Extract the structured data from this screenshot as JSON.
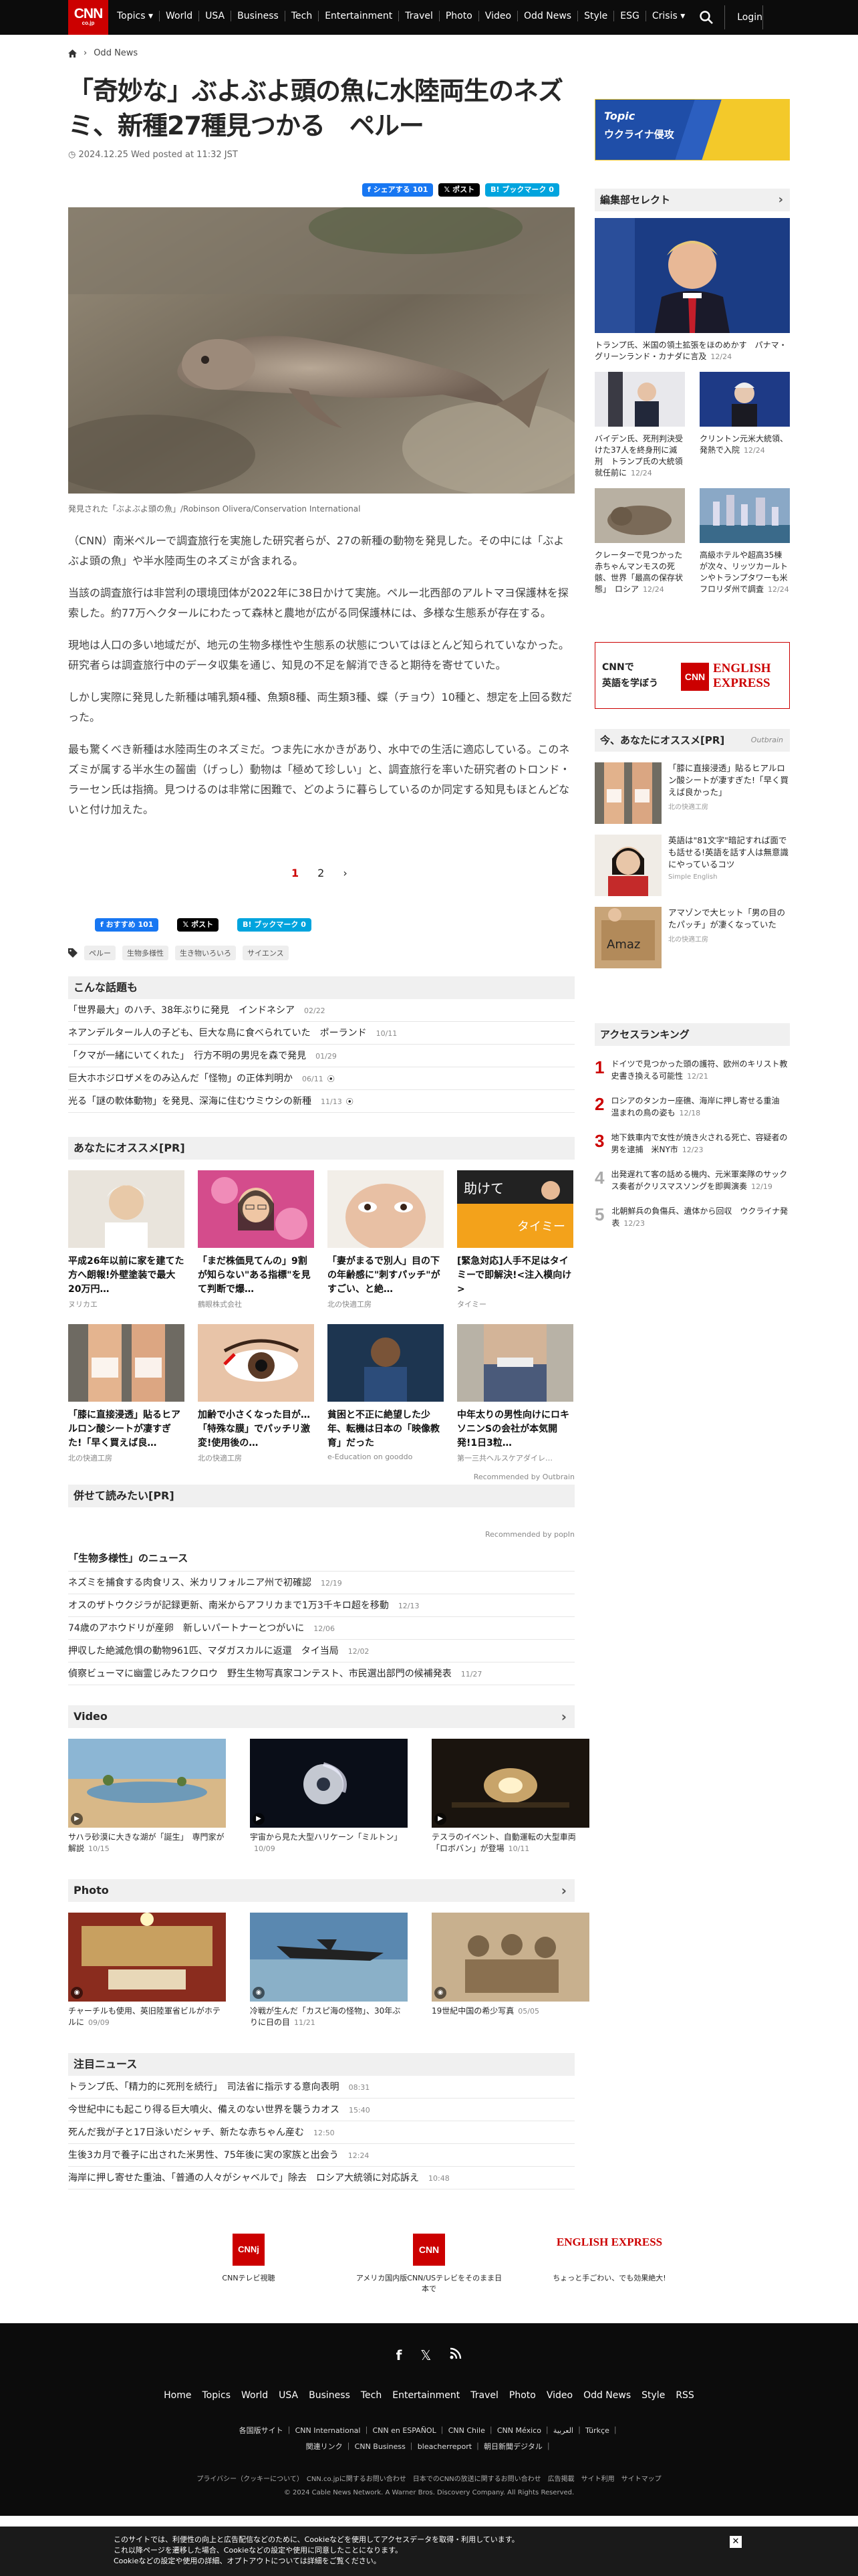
{
  "header": {
    "logo": "CNN",
    "logo_sub": "co.jp",
    "nav": [
      "Topics ▾",
      "World",
      "USA",
      "Business",
      "Tech",
      "Entertainment",
      "Travel",
      "Photo",
      "Video",
      "Odd News",
      "Style",
      "ESG",
      "Crisis ▾"
    ],
    "login": "Login"
  },
  "breadcrumb": {
    "current": "Odd News"
  },
  "article": {
    "title": "「奇妙な」ぶよぶよ頭の魚に水陸両生のネズミ、新種27種見つかる　ペルー",
    "date": "2024.12.25 Wed posted at 11:32 JST",
    "share": {
      "facebook": "シェアする 101",
      "x": "ポスト",
      "hatena": "ブックマーク 0"
    },
    "image_caption": "発見された「ぶよぶよ頭の魚」/Robinson Olivera/Conservation International",
    "paragraphs": [
      "（CNN）南米ペルーで調査旅行を実施した研究者らが、27の新種の動物を発見した。その中には「ぶよぶよ頭の魚」や半水陸両生のネズミが含まれる。",
      "当該の調査旅行は非営利の環境団体が2022年に38日かけて実施。ペルー北西部のアルトマヨ保護林を探索した。約77万ヘクタールにわたって森林と農地が広がる同保護林には、多様な生態系が存在する。",
      "現地は人口の多い地域だが、地元の生物多様性や生態系の状態についてはほとんど知られていなかった。研究者らは調査旅行中のデータ収集を通じ、知見の不足を解消できると期待を寄せていた。",
      "しかし実際に発見した新種は哺乳類4種、魚類8種、両生類3種、蝶（チョウ）10種と、想定を上回る数だった。",
      "最も驚くべき新種は水陸両生のネズミだ。つま先に水かきがあり、水中での生活に適応している。このネズミが属する半水生の齧歯（げっし）動物は「極めて珍しい」と、調査旅行を率いた研究者のトロンド・ラーセン氏は指摘。見つけるのは非常に困難で、どのように暮らしているのか同定する知見もほとんどないと付け加えた。"
    ],
    "pager": [
      "1",
      "2",
      "›"
    ],
    "share2": {
      "facebook": "おすすめ 101",
      "x": "ポスト",
      "hatena": "ブックマーク 0"
    },
    "tags": [
      "ペルー",
      "生物多様性",
      "生き物いろいろ",
      "サイエンス"
    ]
  },
  "related": {
    "heading": "こんな話題も",
    "items": [
      {
        "t": "「世界最大」のハチ、38年ぶりに発見　インドネシア",
        "d": "02/22"
      },
      {
        "t": "ネアンデルタール人の子ども、巨大な鳥に食べられていた　ポーランド",
        "d": "10/11"
      },
      {
        "t": "「クマが一緒にいてくれた」　行方不明の男児を森で発見",
        "d": "01/29"
      },
      {
        "t": "巨大ホホジロザメをのみ込んだ「怪物」の正体判明か",
        "d": "06/11"
      },
      {
        "t": "光る「謎の軟体動物」を発見、深海に住むウミウシの新種",
        "d": "11/13"
      }
    ]
  },
  "reco": {
    "heading": "あなたにオススメ[PR]",
    "cards": [
      {
        "t": "平成26年以前に家を建てた方へ朗報!外壁塗装で最大20万円…",
        "s": "ヌリカエ"
      },
      {
        "t": "「まだ株価見てんの」9割が知らない\"ある指標\"を見て判断で爆…",
        "s": "鶴眼株式会社"
      },
      {
        "t": "「妻がまるで別人」目の下の年齢感に\"刺すパッチ\"がすごい、と絶…",
        "s": "北の快適工房"
      },
      {
        "t": "[緊急対応]人手不足はタイミーで即解決!<注入模向け>",
        "s": "タイミー"
      },
      {
        "t": "「膝に直接浸透」貼るヒアルロン酸シートが凄すぎた!「早く買えば良…",
        "s": "北の快適工房"
      },
      {
        "t": "加齢で小さくなった目が…「特殊な膜」でパッチリ激変!使用後の…",
        "s": "北の快適工房"
      },
      {
        "t": "貧困と不正に絶望した少年、転機は日本の「映像教育」だった",
        "s": "e-Education on gooddo"
      },
      {
        "t": "中年太りの男性向けにロキソニンSの会社が本気開発!1日3粒…",
        "s": "第一三共ヘルスケアダイレ…"
      }
    ],
    "footer": "Recommended by Outbrain"
  },
  "also": {
    "heading": "併せて読みたい[PR]",
    "powered": "Recommended by popIn"
  },
  "bio": {
    "heading": "「生物多様性」のニュース",
    "items": [
      {
        "t": "ネズミを捕食する肉食リス、米カリフォルニア州で初確認",
        "d": "12/19"
      },
      {
        "t": "オスのザトウクジラが記録更新、南米からアフリカまで1万3千キロ超を移動",
        "d": "12/13"
      },
      {
        "t": "74歳のアホウドリが産卵　新しいパートナーとつがいに",
        "d": "12/06"
      },
      {
        "t": "押収した絶滅危惧の動物961匹、マダガスカルに返還　タイ当局",
        "d": "12/02"
      },
      {
        "t": "偵察ビューマに幽霊じみたフクロウ　野生生物写真家コンテスト、市民選出部門の候補発表",
        "d": "11/27"
      }
    ]
  },
  "video": {
    "heading": "Video",
    "items": [
      {
        "t": "サハラ砂漠に大きな湖が「誕生」　専門家が解説",
        "d": "10/15"
      },
      {
        "t": "宇宙から見た大型ハリケーン「ミルトン」",
        "d": "10/09"
      },
      {
        "t": "テスラのイベント、自動運転の大型車両「ロボバン」が登場",
        "d": "10/11"
      }
    ]
  },
  "photo": {
    "heading": "Photo",
    "items": [
      {
        "t": "チャーチルも使用、英旧陸軍省ビルがホテルに",
        "d": "09/09"
      },
      {
        "t": "冷戦が生んだ「カスピ海の怪物」、30年ぶりに日の目",
        "d": "11/21"
      },
      {
        "t": "19世紀中国の希少写真",
        "d": "05/05"
      }
    ]
  },
  "attn": {
    "heading": "注目ニュース",
    "items": [
      {
        "t": "トランプ氏、「精力的に死刑を続行」　司法省に指示する意向表明",
        "d": "08:31"
      },
      {
        "t": "今世紀中にも起こり得る巨大噴火、備えのない世界を襲うカオス",
        "d": "15:40"
      },
      {
        "t": "死んだ我が子と17日泳いだシャチ、新たな赤ちゃん産む",
        "d": "12:50"
      },
      {
        "t": "生後3カ月で養子に出された米男性、75年後に実の家族と出会う",
        "d": "12:24"
      },
      {
        "t": "海岸に押し寄せた重油、「普通の人々がシャベルで」除去　ロシア大統領に対応訴え",
        "d": "10:48"
      }
    ]
  },
  "right": {
    "topic_label": "Topic",
    "topic_title": "ウクライナ侵攻",
    "editors": {
      "heading": "編集部セレクト",
      "big": {
        "t": "トランプ氏、米国の領土拡張をほのめかす　パナマ・グリーンランド・カナダに言及",
        "d": "12/24"
      },
      "pairs": [
        {
          "t": "バイデン氏、死刑判決受けた37人を終身刑に減刑　トランプ氏の大統領就任前に",
          "d": "12/24"
        },
        {
          "t": "クリントン元米大統領、発熱で入院",
          "d": "12/24"
        },
        {
          "t": "クレーターで見つかった赤ちゃんマンモスの死骸、世界「最高の保存状態」　ロシア",
          "d": "12/24"
        },
        {
          "t": "高級ホテルや超高35棟が次々、リッツカールトンやトランプタワーも米フロリダ州で調査",
          "d": "12/24"
        }
      ]
    },
    "english": {
      "l1": "CNNで",
      "l2": "英語を学ぼう",
      "logo": "ENGLISH EXPRESS"
    },
    "outbrain": {
      "heading": "今、あなたにオススメ[PR]",
      "brand": "Outbrain",
      "items": [
        {
          "t": "「膝に直接浸透」貼るヒアルロン酸シートが凄すぎた!「早く買えば良かった」",
          "s": "北の快適工房"
        },
        {
          "t": "英語は\"81文字\"暗記すれば面でも話せる!英語を話す人は無意識にやっているコツ",
          "s": "Simple English"
        },
        {
          "t": "アマゾンで大ヒット「男の目のたパッチ」が凄くなっていた",
          "s": "北の快適工房"
        }
      ]
    },
    "ranking": {
      "heading": "アクセスランキング",
      "items": [
        {
          "n": "1",
          "t": "ドイツで見つかった頭の護符、欧州のキリスト教史書き換える可能性",
          "d": "12/21"
        },
        {
          "n": "2",
          "t": "ロシアのタンカー座礁、海岸に押し寄せる重油　温まれの鳥の姿も",
          "d": "12/18"
        },
        {
          "n": "3",
          "t": "地下鉄車内で女性が焼き火される死亡、容疑者の男を逮捕　米NY市",
          "d": "12/23"
        },
        {
          "n": "4",
          "t": "出発遅れて客の話める機内、元米軍楽隊のサックス奏者がクリスマスソングを即興演奏",
          "d": "12/19"
        },
        {
          "n": "5",
          "t": "北朝鮮兵の負傷兵、遺体から回収　ウクライナ発表",
          "d": "12/23"
        }
      ]
    }
  },
  "footlogos": [
    {
      "logo": "CNNj",
      "t": "CNNテレビ視聴"
    },
    {
      "logo": "CNN",
      "t": "アメリカ国内版CNN/USテレビをそのまま日本で"
    },
    {
      "logo": "ENGLISH EXPRESS",
      "t": "ちょっと手ごわい、でも効果絶大!"
    }
  ],
  "footer": {
    "nav": [
      "Home",
      "Topics",
      "World",
      "USA",
      "Business",
      "Tech",
      "Entertainment",
      "Travel",
      "Photo",
      "Video",
      "Odd News",
      "Style",
      "RSS"
    ],
    "l1": "各国版サイト ｜ CNN International ｜ CNN en ESPAÑOL ｜ CNN Chile ｜ CNN México ｜ العربية ｜ Türkçe ｜",
    "l2": "関連リンク ｜ CNN Business ｜ bleacherreport ｜ 朝日新聞デジタル ｜",
    "l3": "プライバシー（クッキーについて）　CNN.co.jpに関するお問い合わせ　日本でのCNNの放送に関するお問い合わせ　広告掲載　サイト利用　サイトマップ",
    "copyright": "© 2024 Cable News Network. A Warner Bros. Discovery Company. All Rights Reserved."
  },
  "cookie": {
    "l1": "このサイトでは、利便性の向上と広告配信などのために、Cookieなどを使用してアクセスデータを取得・利用しています。",
    "l2": "これ以降ページを遷移した場合、Cookieなどの設定や使用に同意したことになります。",
    "l3": "Cookieなどの設定や使用の詳細、オプトアウトについては詳細をご覧ください。"
  }
}
